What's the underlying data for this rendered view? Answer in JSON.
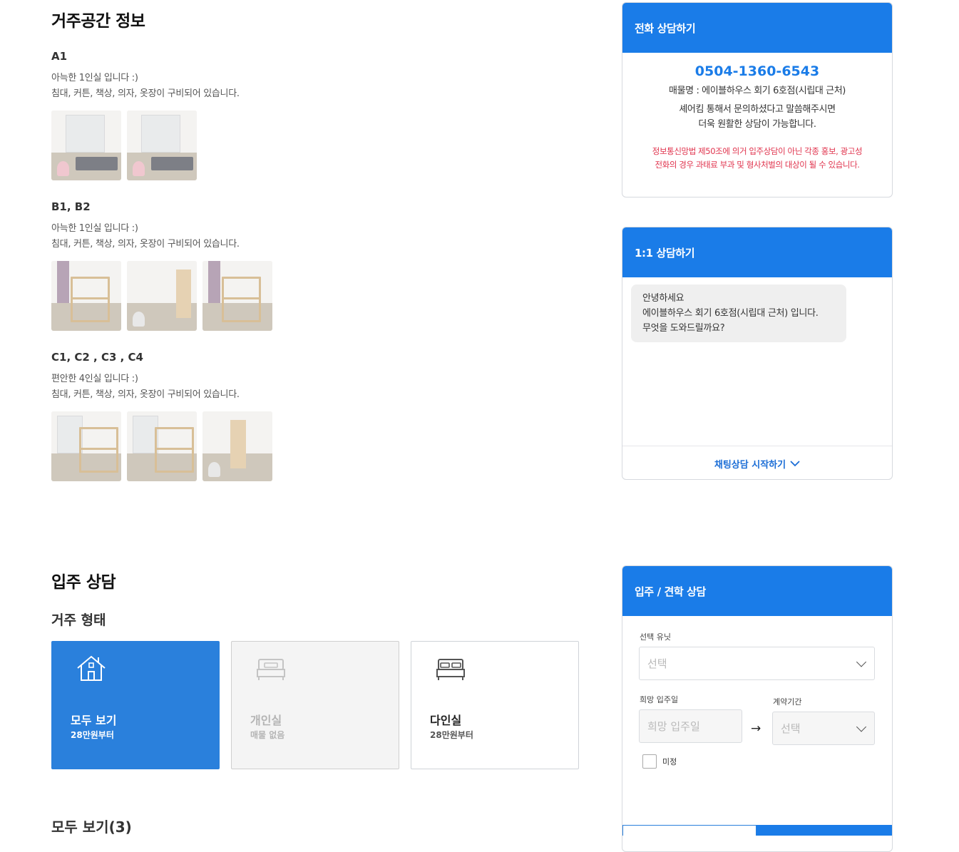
{
  "residence": {
    "title": "거주공간 정보",
    "rooms": [
      {
        "name": "A1",
        "desc": "아늑한 1인실 입니다 :)\n침대, 커튼, 책상, 의자, 옷장이 구비되어 있습니다."
      },
      {
        "name": "B1, B2",
        "desc": "아늑한 1인실 입니다 :)\n침대, 커튼, 책상, 의자, 옷장이 구비되어 있습니다."
      },
      {
        "name": "C1, C2 , C3 , C4",
        "desc": "편안한 4인실 입니다 :)\n침대, 커튼, 책상, 의자, 옷장이 구비되어 있습니다."
      }
    ]
  },
  "phone_panel": {
    "title": "전화 상담하기",
    "number": "0504-1360-6543",
    "property": "매물명 : 에이블하우스 회기 6호점(시립대 근처)",
    "note_line1": "셰어킴 통해서 문의하셨다고 말씀해주시면",
    "note_line2": "더욱 원활한 상담이 가능합니다.",
    "warn_line1": "정보통신망법 제50조에 의거 입주상담이 아닌 각종 홍보, 광고성",
    "warn_line2": "전화의 경우 과태료 부과 및 형사처벌의 대상이 될 수 있습니다."
  },
  "chat_panel": {
    "title": "1:1 상담하기",
    "message": "안녕하세요\n에이블하우스 회기 6호점(시립대 근처) 입니다.\n무엇을 도와드릴까요?",
    "start_label": "채팅상담 시작하기"
  },
  "movein": {
    "title": "입주 상담",
    "type_heading": "거주 형태",
    "types": [
      {
        "title": "모두 보기",
        "sub": "28만원부터",
        "icon": "house-icon"
      },
      {
        "title": "개인실",
        "sub": "매물 없음",
        "icon": "single-bed-icon"
      },
      {
        "title": "다인실",
        "sub": "28만원부터",
        "icon": "double-bed-icon"
      }
    ],
    "list_heading": "모두 보기(3)"
  },
  "form_panel": {
    "title": "입주 / 견학 상담",
    "unit_label": "선택 유닛",
    "unit_placeholder": "선택",
    "date_label": "희망 입주일",
    "date_placeholder": "희망 입주일",
    "arrow": "→",
    "term_label": "계약기간",
    "term_placeholder": "선택",
    "undecided_label": "미정"
  },
  "colors": {
    "accent": "#1a7ce8",
    "card_active": "#2a80dc",
    "warning": "#e0334d"
  }
}
